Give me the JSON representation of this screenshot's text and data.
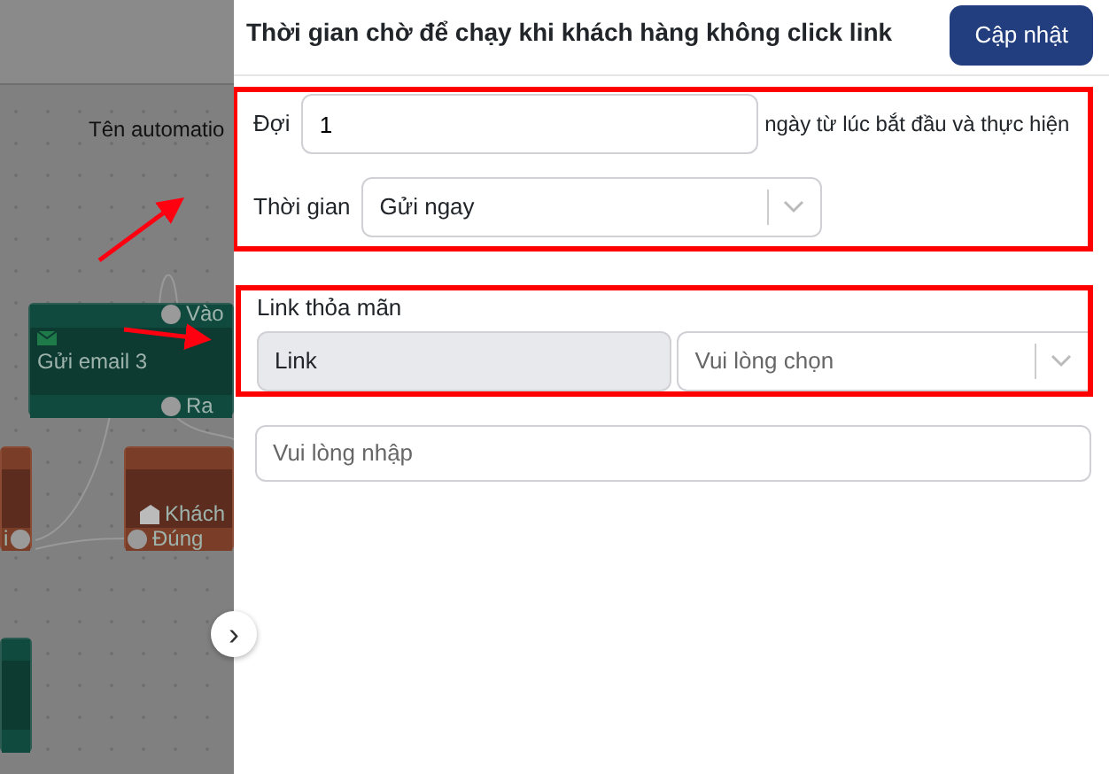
{
  "canvas": {
    "header_text": "Tên automatio",
    "nodes": [
      {
        "kind": "email",
        "title": "Gửi email 3",
        "in_port": "Vào",
        "out_port": "Ra"
      },
      {
        "kind": "condition",
        "out_port": "i"
      },
      {
        "kind": "condition",
        "title": "Khách",
        "out_port": "Đúng"
      },
      {
        "kind": "action"
      }
    ],
    "collapse_button": "›"
  },
  "panel": {
    "title": "Thời gian chờ để chạy khi khách hàng không click link",
    "update_button": "Cập nhật",
    "wait": {
      "label": "Đợi",
      "value": "1",
      "suffix": "ngày từ lúc bắt đầu và thực hiện"
    },
    "time": {
      "label": "Thời gian",
      "value": "Gửi ngay"
    },
    "link": {
      "label": "Link thỏa mãn",
      "prefix": "Link",
      "placeholder": "Vui lòng chọn"
    },
    "note": {
      "placeholder": "Vui lòng nhập"
    }
  }
}
